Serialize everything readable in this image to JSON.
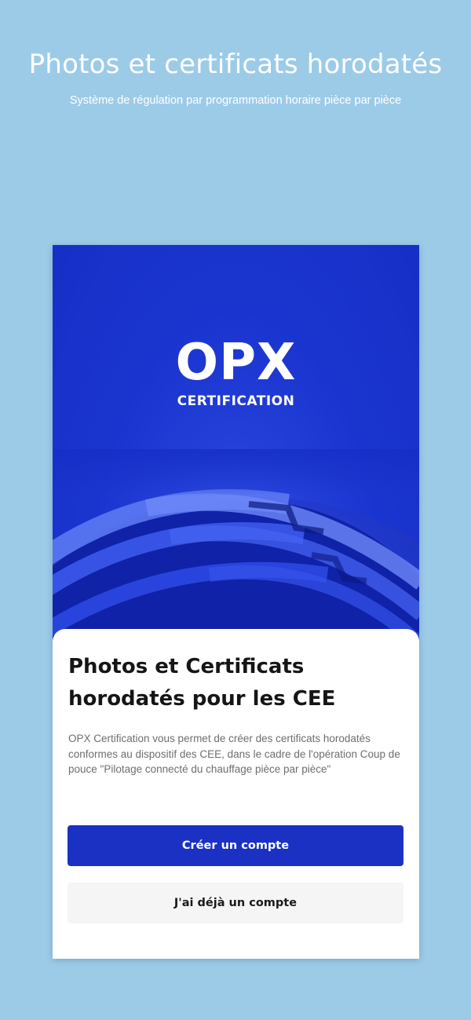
{
  "promo": {
    "title": "Photos et certificats horodatés",
    "subtitle": "Système de régulation par programmation horaire pièce par pièce"
  },
  "app": {
    "logo": {
      "wordmark": "OPX",
      "subtext": "CERTIFICATION"
    },
    "hero": {
      "art": "blue-sphere-stripes"
    },
    "sheet": {
      "title": "Photos et Certificats horodatés pour les CEE",
      "description": "OPX Certification vous permet de créer des certificats horodatés conformes au dispositif des CEE, dans le cadre de l'opération Coup de pouce \"Pilotage connecté du chauffage pièce par pièce\"",
      "create_account_label": "Créer un compte",
      "have_account_label": "J'ai déjà un compte"
    }
  },
  "colors": {
    "background": "#9ccbe8",
    "hero_blue": "#1a34cf",
    "primary_button": "#1a31c4",
    "secondary_button": "#f5f5f5"
  }
}
